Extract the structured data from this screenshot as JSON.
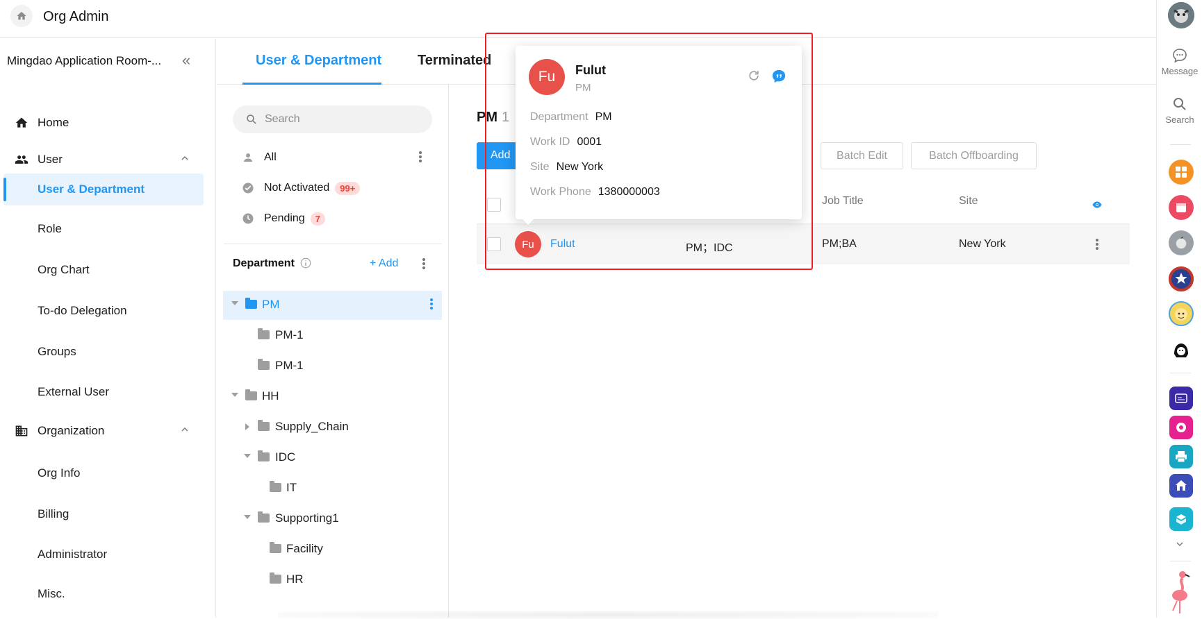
{
  "app": {
    "title": "Org Admin"
  },
  "org": {
    "name": "Mingdao Application Room-..."
  },
  "nav": {
    "home": "Home",
    "user_group": "User",
    "user_items": [
      "User & Department",
      "Role",
      "Org Chart",
      "To-do Delegation",
      "Groups",
      "External User"
    ],
    "org_group": "Organization",
    "org_items": [
      "Org Info",
      "Billing",
      "Administrator",
      "Misc."
    ]
  },
  "tabs": [
    "User & Department",
    "Terminated"
  ],
  "search": {
    "placeholder": "Search"
  },
  "filters": {
    "all": "All",
    "not_activated": "Not Activated",
    "not_activated_count": "99+",
    "pending": "Pending",
    "pending_count": "7"
  },
  "department": {
    "title": "Department",
    "add": "+ Add",
    "tree": [
      {
        "label": "PM",
        "level": 0,
        "expanded": true,
        "selected": true
      },
      {
        "label": "PM-1",
        "level": 1
      },
      {
        "label": "PM-1",
        "level": 1
      },
      {
        "label": "HH",
        "level": 0,
        "expanded": true
      },
      {
        "label": "Supply_Chain",
        "level": 1,
        "collapsed": true
      },
      {
        "label": "IDC",
        "level": 1,
        "expanded": true
      },
      {
        "label": "IT",
        "level": 2
      },
      {
        "label": "Supporting1",
        "level": 1,
        "expanded": true
      },
      {
        "label": "Facility",
        "level": 2
      },
      {
        "label": "HR",
        "level": 2
      }
    ]
  },
  "main": {
    "heading": "PM",
    "count": "1",
    "add_button": "Add",
    "batch_edit": "Batch Edit",
    "batch_offboarding": "Batch Offboarding",
    "columns": [
      "Job Title",
      "Site"
    ],
    "row": {
      "avatar": "Fu",
      "name": "Fulut",
      "department": "PM；IDC",
      "job_title": "PM;BA",
      "site": "New York"
    }
  },
  "popover": {
    "avatar": "Fu",
    "name": "Fulut",
    "title": "PM",
    "fields": [
      {
        "key": "Department",
        "value": "PM"
      },
      {
        "key": "Work ID",
        "value": "0001"
      },
      {
        "key": "Site",
        "value": "New York"
      },
      {
        "key": "Work Phone",
        "value": "1380000003"
      }
    ]
  },
  "rail": {
    "message": "Message",
    "search": "Search"
  },
  "colors": {
    "accent": "#2196f3",
    "avatar": "#e8514a",
    "badge_text": "#f44336",
    "highlight": "#ef1c24"
  }
}
